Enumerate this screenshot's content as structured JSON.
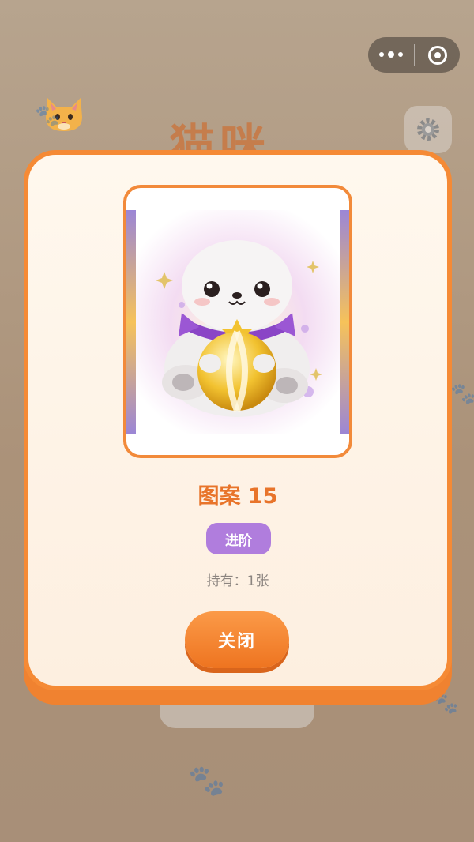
{
  "background": {
    "title_ghost": "猫咪"
  },
  "modal": {
    "card_name": "图案 15",
    "rarity": "进阶",
    "owned": "持有：1张",
    "close_label": "关闭"
  },
  "colors": {
    "accent": "#f58a35",
    "badge": "#b07ddd",
    "card_name": "#e8742a"
  }
}
